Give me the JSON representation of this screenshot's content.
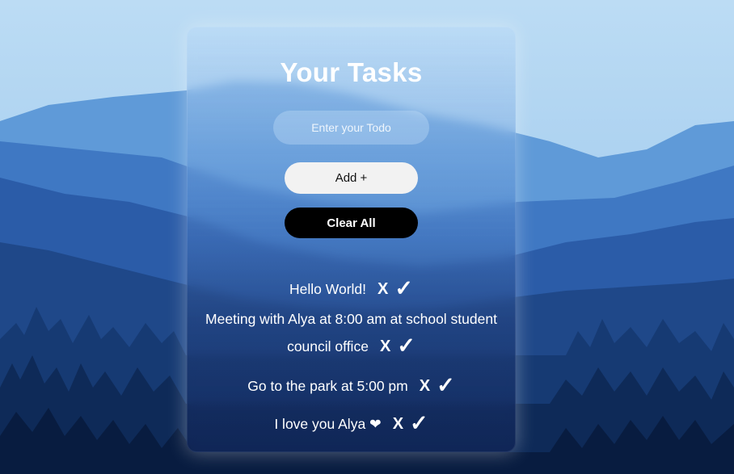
{
  "header": {
    "title": "Your Tasks"
  },
  "input": {
    "placeholder": "Enter your Todo",
    "value": ""
  },
  "buttons": {
    "add_label": "Add +",
    "clear_label": "Clear All"
  },
  "tasks": [
    {
      "text": "Hello World!",
      "delete": "X",
      "complete": "✓"
    },
    {
      "text": "Meeting with Alya at 8:00 am at school student council office",
      "delete": "X",
      "complete": "✓"
    },
    {
      "text": "Go to the park at 5:00 pm",
      "delete": "X",
      "complete": "✓"
    },
    {
      "text": "I love you Alya ❤",
      "delete": "X",
      "complete": "✓"
    }
  ]
}
